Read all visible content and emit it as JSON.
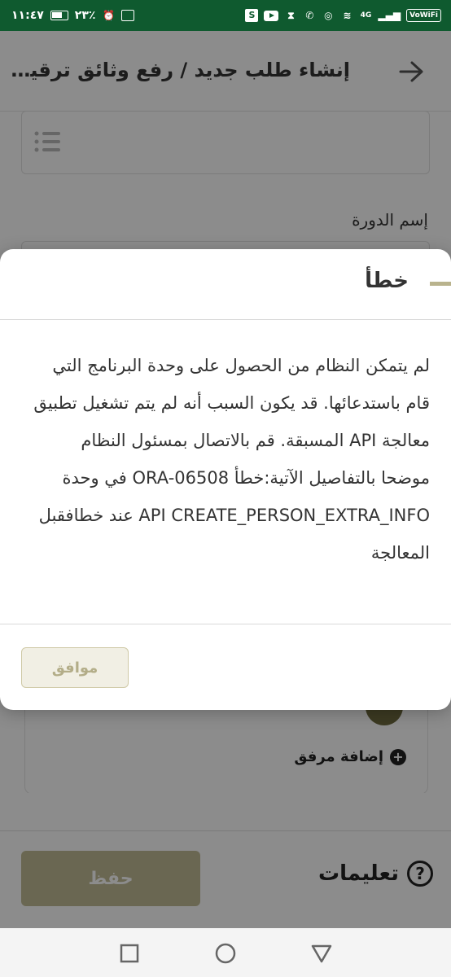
{
  "status_bar": {
    "time": "١١:٤٧",
    "battery": "٢٣٪",
    "network": "4G",
    "vowifi": "VoWiFi"
  },
  "header": {
    "title": "إنشاء طلب جديد / رفع وثائق ترقية ..."
  },
  "form": {
    "course_name_label": "إسم الدورة"
  },
  "attachments": {
    "add_label": "إضافة مرفق"
  },
  "bottom_bar": {
    "save_label": "حفظ",
    "instructions_label": "تعليمات"
  },
  "dialog": {
    "title": "خطأ",
    "message": "لم يتمكن النظام من الحصول على وحدة البرنامج التي قام باستدعائها. قد يكون السبب أنه لم يتم تشغيل تطبيق معالجة API المسبقة. قم بالاتصال بمسئول النظام موضحا بالتفاصيل الآتية:خطأ ORA-06508 في وحدة API CREATE_PERSON_EXTRA_INFO عند خطافقبل المعالجة",
    "ok_label": "موافق"
  },
  "colors": {
    "status_bar_bg": "#0f5a2f",
    "accent": "#b9b38d",
    "save_button_bg": "#c2bc95"
  }
}
